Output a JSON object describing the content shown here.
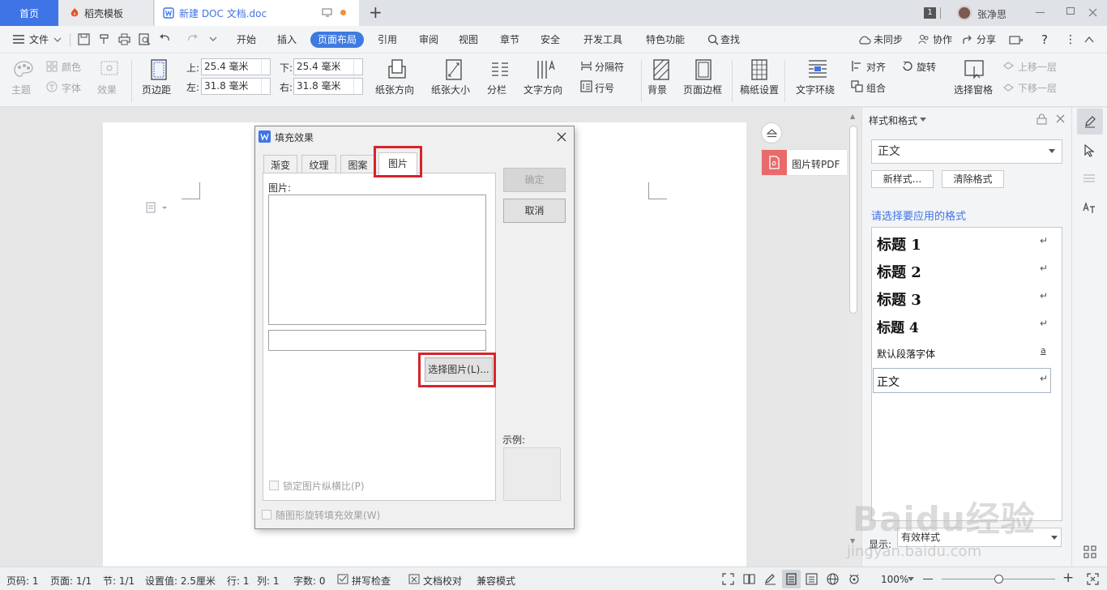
{
  "tabs": {
    "home": "首页",
    "template": "稻壳模板",
    "document": "新建 DOC 文档.doc"
  },
  "titlebar": {
    "badge": "1",
    "user_name": "张净思"
  },
  "menu": {
    "file": "文件",
    "items": [
      "开始",
      "插入",
      "页面布局",
      "引用",
      "审阅",
      "视图",
      "章节",
      "安全",
      "开发工具",
      "特色功能"
    ],
    "search": "查找",
    "sync": "未同步",
    "collab": "协作",
    "share": "分享"
  },
  "ribbon": {
    "theme": "主题",
    "color": "颜色",
    "font": "字体",
    "effect": "效果",
    "margins": "页边距",
    "top_label": "上:",
    "top_value": "25.4 毫米",
    "bottom_label": "下:",
    "bottom_value": "25.4 毫米",
    "left_label": "左:",
    "left_value": "31.8 毫米",
    "right_label": "右:",
    "right_value": "31.8 毫米",
    "orientation": "纸张方向",
    "size": "纸张大小",
    "columns": "分栏",
    "text_direction": "文字方向",
    "breaks": "分隔符",
    "line_numbers": "行号",
    "background": "背景",
    "page_border": "页面边框",
    "draft_paper": "稿纸设置",
    "wrap_text": "文字环绕",
    "align": "对齐",
    "rotate": "旋转",
    "group": "组合",
    "selection_pane": "选择窗格",
    "bring_forward": "上移一层",
    "send_backward": "下移一层"
  },
  "dialog": {
    "title": "填充效果",
    "tabs": [
      "渐变",
      "纹理",
      "图案",
      "图片"
    ],
    "picture_label": "图片:",
    "select_picture": "选择图片(L)...",
    "lock_ratio": "锁定图片纵横比(P)",
    "rotate_with_shape": "随图形旋转填充效果(W)",
    "ok": "确定",
    "cancel": "取消",
    "example_label": "示例:"
  },
  "pdf_button": "图片转PDF",
  "styles_panel": {
    "title": "样式和格式",
    "current_style": "正文",
    "new_style": "新样式...",
    "clear_format": "清除格式",
    "prompt": "请选择要应用的格式",
    "items": [
      "标题 1",
      "标题 2",
      "标题 3",
      "标题 4",
      "默认段落字体",
      "正文"
    ],
    "show_label": "显示:",
    "show_value": "有效样式"
  },
  "statusbar": {
    "page_num": "页码: 1",
    "pages": "页面: 1/1",
    "section": "节: 1/1",
    "setting": "设置值: 2.5厘米",
    "row": "行: 1",
    "column": "列: 1",
    "word_count": "字数: 0",
    "spell_check": "拼写检查",
    "doc_check": "文档校对",
    "compat_mode": "兼容模式",
    "zoom": "100%",
    "zoom_fraction": 0.5
  },
  "watermark": {
    "text": "Baidu经验",
    "url": "jingyan.baidu.com"
  },
  "colors": {
    "accent": "#3e74e6",
    "highlight_red": "#d9232a",
    "pdf_red": "#e96a6a"
  }
}
